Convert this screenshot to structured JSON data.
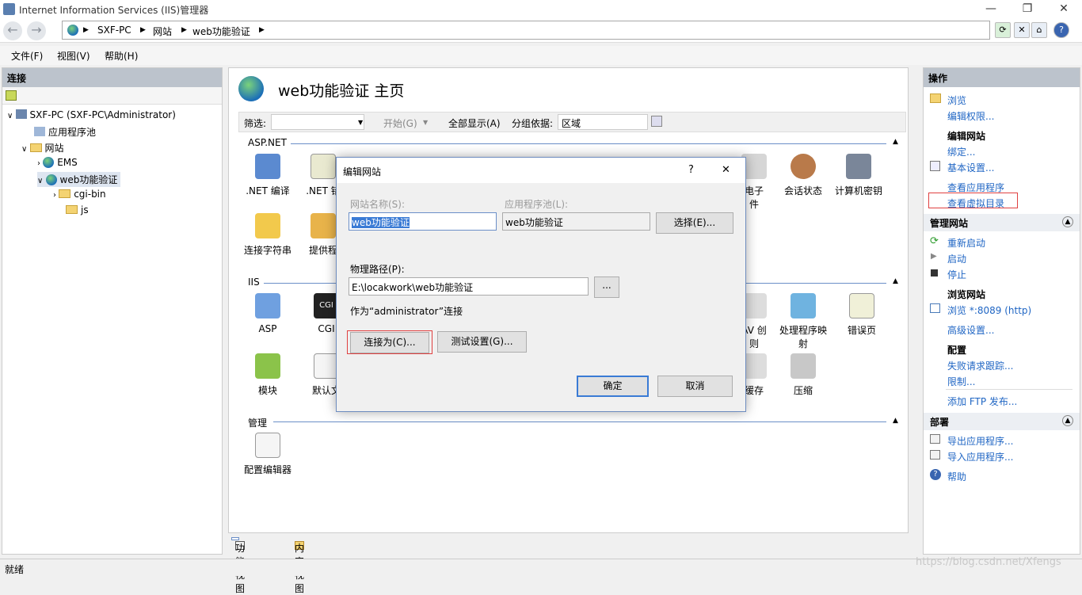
{
  "window": {
    "title": "Internet Information Services (IIS)管理器"
  },
  "address": {
    "crumbs": [
      "SXF-PC",
      "网站",
      "web功能验证"
    ]
  },
  "menu": [
    "文件(F)",
    "视图(V)",
    "帮助(H)"
  ],
  "connections": {
    "header": "连接",
    "tree": {
      "server": "SXF-PC (SXF-PC\\Administrator)",
      "apppools": "应用程序池",
      "sites": "网站",
      "ems": "EMS",
      "site": "web功能验证",
      "cgibin": "cgi-bin",
      "js": "js"
    }
  },
  "center": {
    "title": "web功能验证 主页",
    "filter": {
      "label": "筛选:",
      "start": "开始(G)",
      "showall": "全部显示(A)",
      "groupby": "分组依据:",
      "groupval": "区域"
    },
    "sections": {
      "aspnet": "ASP.NET",
      "iis": "IIS",
      "mgmt": "管理"
    },
    "features": {
      "net_compile": ".NET 编译",
      "net_error": ".NET 错",
      "conn_strings": "连接字符串",
      "providers": "提供程",
      "email": "电子",
      "email2": "件",
      "session": "会话状态",
      "machinekey": "计算机密钥",
      "asp": "ASP",
      "cgi": "CGI",
      "webdav": "AV 创",
      "webdav2": "则",
      "handlers": "处理程序映",
      "handlers2": "射",
      "errorpages": "错误页",
      "modules": "模块",
      "defaultdoc": "默认文",
      "cache": "缓存",
      "compress": "压缩",
      "config_editor": "配置编辑器"
    },
    "tabs": {
      "feature": "功能视图",
      "content": "内容视图"
    }
  },
  "actions": {
    "header": "操作",
    "browse": "浏览",
    "edit_perms": "编辑权限...",
    "edit_site": "编辑网站",
    "bindings": "绑定...",
    "basic_settings": "基本设置...",
    "view_apps": "查看应用程序",
    "view_vdirs": "查看虚拟目录",
    "manage_site": "管理网站",
    "restart": "重新启动",
    "start": "启动",
    "stop": "停止",
    "browse_site": "浏览网站",
    "browse_port": "浏览 *:8089 (http)",
    "advanced": "高级设置...",
    "config": "配置",
    "failed_req": "失败请求跟踪...",
    "limits": "限制...",
    "ftp": "添加 FTP 发布...",
    "deploy": "部署",
    "export_app": "导出应用程序...",
    "import_app": "导入应用程序...",
    "help": "帮助"
  },
  "status": {
    "text": "就绪",
    "watermark": "https://blog.csdn.net/Xfengs"
  },
  "dialog": {
    "title": "编辑网站",
    "help": "?",
    "close": "✕",
    "site_name_label": "网站名称(S):",
    "site_name": "web功能验证",
    "pool_label": "应用程序池(L):",
    "pool": "web功能验证",
    "select": "选择(E)...",
    "path_label": "物理路径(P):",
    "path": "E:\\locakwork\\web功能验证",
    "browse": "...",
    "connect_as_text": "作为“administrator”连接",
    "connect_as": "连接为(C)...",
    "test": "测试设置(G)...",
    "ok": "确定",
    "cancel": "取消"
  }
}
